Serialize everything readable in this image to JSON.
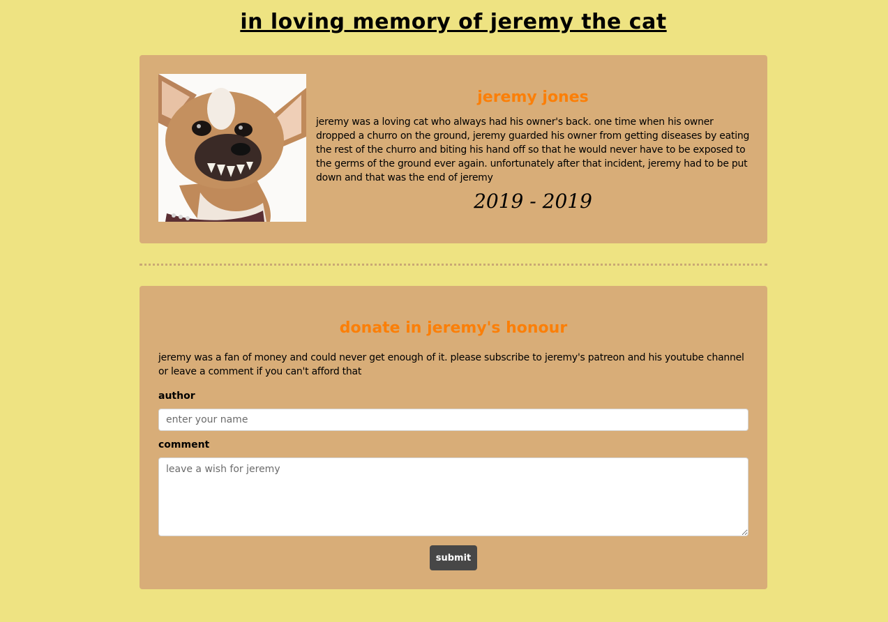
{
  "page": {
    "title": "in loving memory of jeremy the cat"
  },
  "memorial": {
    "photo_icon": "chihuahua-photo",
    "name": "jeremy jones",
    "bio": "jeremy was a loving cat who always had his owner's back. one time when his owner dropped a churro on the ground, jeremy guarded his owner from getting diseases by eating the rest of the churro and biting his hand off so that he would never have to be exposed to the germs of the ground ever again. unfortunately after that incident, jeremy had to be put down and that was the end of jeremy",
    "dates": "2019 - 2019"
  },
  "donate": {
    "title": "donate in jeremy's honour",
    "text": "jeremy was a fan of money and could never get enough of it. please subscribe to jeremy's patreon and his youtube channel or leave a comment if you can't afford that",
    "author_label": "author",
    "author_value": "",
    "author_placeholder": "enter your name",
    "comment_label": "comment",
    "comment_value": "",
    "comment_placeholder": "leave a wish for jeremy",
    "submit_label": "submit"
  },
  "colors": {
    "page_background": "#eee382",
    "card_background": "#d8ad78",
    "heading_accent": "#fb7f08",
    "button_background": "#474747"
  }
}
